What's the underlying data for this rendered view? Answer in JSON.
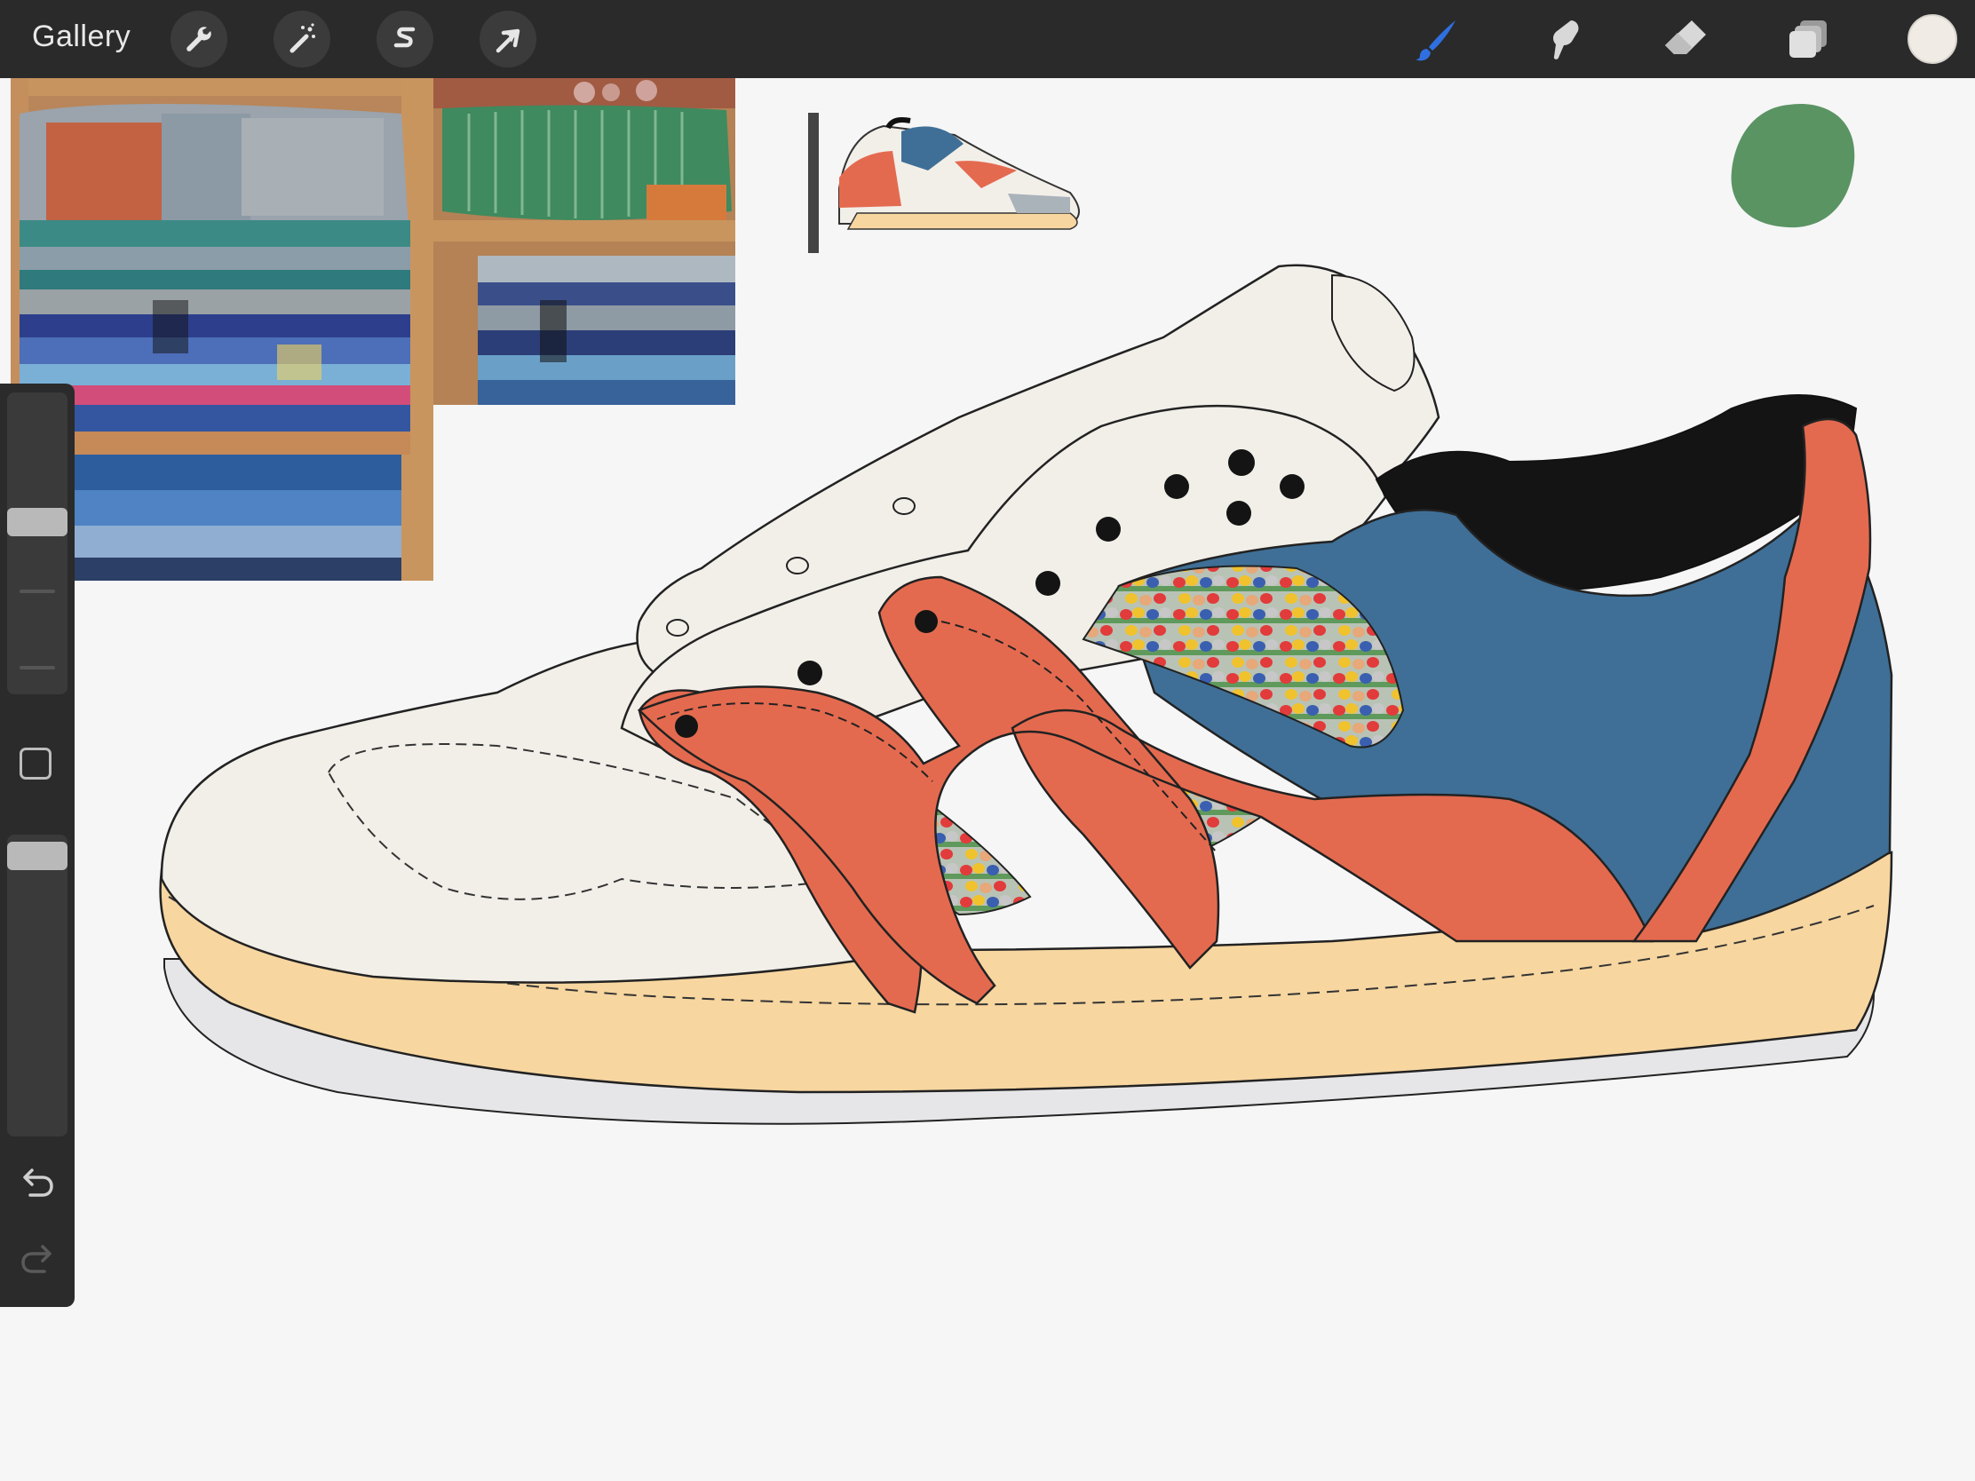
{
  "topbar": {
    "gallery_label": "Gallery",
    "left_tools": [
      "wrench-icon",
      "magic-wand-icon",
      "selection-s-icon",
      "transform-arrow-icon"
    ],
    "right_tools": [
      "brush-icon",
      "smudge-icon",
      "eraser-icon",
      "layers-icon"
    ],
    "active_tool": "brush-icon",
    "current_color": "#f0ebe4",
    "accent_color": "#2f6fe0"
  },
  "sidebar": {
    "tools": [
      "brush-size-slider",
      "modify-button",
      "opacity-slider",
      "undo-icon",
      "redo-icon"
    ]
  },
  "canvas": {
    "reference_images": [
      "folded-blankets-photo",
      "woven-textiles-shelf-photo"
    ],
    "palette": {
      "orange": "#e46a4f",
      "blue": "#3f6f96",
      "black": "#141414",
      "cream": "#f2efe9",
      "sole": "#f7d6a0",
      "green_blob": "#5a9463"
    }
  }
}
